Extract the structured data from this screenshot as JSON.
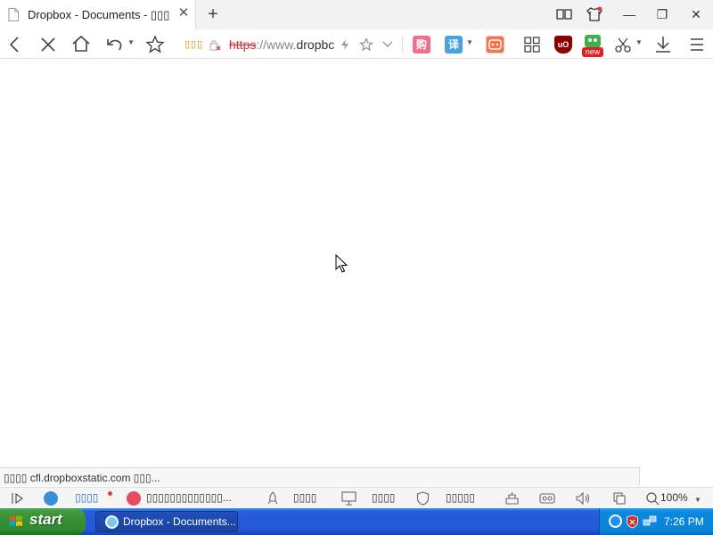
{
  "tab": {
    "title": "Dropbox - Documents - ▯▯▯▯",
    "close_glyph": "✕"
  },
  "tabbar": {
    "new_tab_glyph": "+"
  },
  "window_controls": {
    "minimize_glyph": "—",
    "restore_glyph": "❐",
    "close_glyph": "✕"
  },
  "address": {
    "site_tag": "▯▯▯",
    "scheme": "https",
    "sep": "://",
    "www": "www.",
    "host": "dropbc"
  },
  "extensions": {
    "shop_label": "购",
    "translate_label": "译",
    "ublock_label": "uO",
    "new_badge": "new"
  },
  "status_hover": "▯▯▯▯ cfl.dropboxstatic.com ▯▯▯...",
  "bottom_bar": {
    "item1": "▯▯▯▯",
    "item2": "▯▯▯▯▯▯▯▯▯▯▯▯▯...",
    "item3": "▯▯▯▯",
    "item4": "▯▯▯▯",
    "item5": "▯▯▯▯▯",
    "zoom": "100%"
  },
  "taskbar": {
    "start_label": "start",
    "window_label": "Dropbox - Documents...",
    "clock": "7:26 PM"
  },
  "colors": {
    "taskbar_blue": "#245edb",
    "start_green": "#3c963c",
    "tray_blue": "#0b87dd",
    "ublock_red": "#8b0000",
    "shop_pink": "#ee6f8a",
    "translate_blue": "#4aa3df",
    "game_orange": "#f5734d",
    "new_badge_red": "#e02020"
  }
}
